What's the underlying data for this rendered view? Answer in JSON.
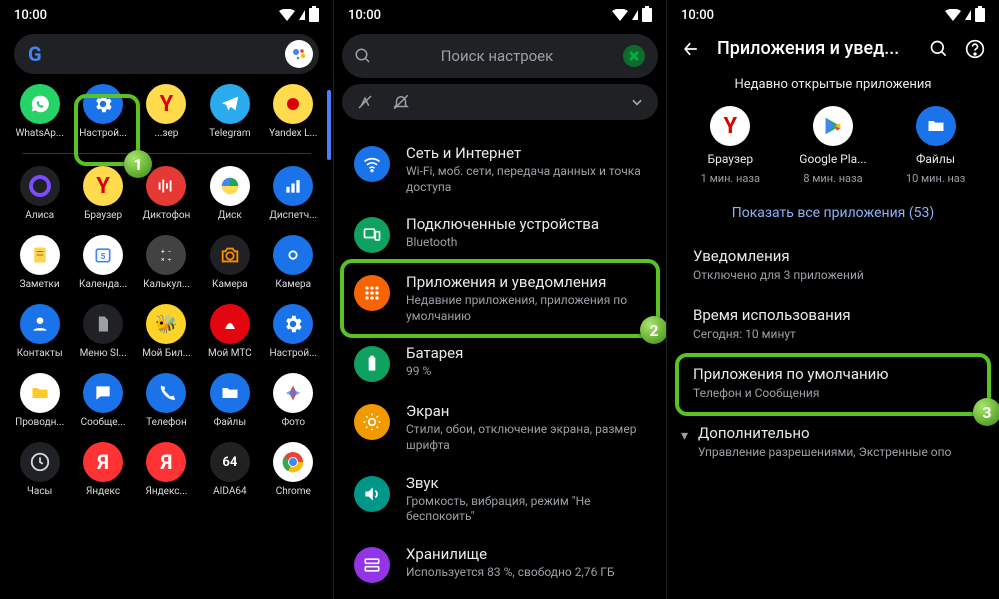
{
  "status_time": "10:00",
  "p1": {
    "apps": [
      [
        {
          "name": "WhatsAp...",
          "bg": "#25d366",
          "glyph": "wa"
        },
        {
          "name": "Настрой...",
          "bg": "#1a73e8",
          "glyph": "gear"
        },
        {
          "name": "...зер",
          "bg": "#ffdb4d",
          "glyph": "Y"
        },
        {
          "name": "Telegram",
          "bg": "#2aabee",
          "glyph": "tg"
        },
        {
          "name": "Yandex L...",
          "bg": "#ffdb4d",
          "glyph": "dot"
        }
      ],
      [
        {
          "name": "Алиса",
          "bg": "#202124",
          "glyph": "circle"
        },
        {
          "name": "Браузер",
          "bg": "#ffdb4d",
          "glyph": "Y"
        },
        {
          "name": "Диктофон",
          "bg": "#e53935",
          "glyph": "rec"
        },
        {
          "name": "Диск",
          "bg": "#fff",
          "glyph": "disk"
        },
        {
          "name": "Диспетч...",
          "bg": "#1a73e8",
          "glyph": "bars"
        }
      ],
      [
        {
          "name": "Заметки",
          "bg": "#fff",
          "glyph": "note"
        },
        {
          "name": "Календа...",
          "bg": "#fff",
          "glyph": "cal"
        },
        {
          "name": "Калькул...",
          "bg": "#424242",
          "glyph": "calc"
        },
        {
          "name": "Камера",
          "bg": "#202124",
          "glyph": "cam"
        },
        {
          "name": "Камера",
          "bg": "#1a73e8",
          "glyph": "cam2"
        }
      ],
      [
        {
          "name": "Контакты",
          "bg": "#1a73e8",
          "glyph": "contact"
        },
        {
          "name": "Меню SI...",
          "bg": "#202124",
          "glyph": "sim"
        },
        {
          "name": "Мой Бил...",
          "bg": "#fed42b",
          "glyph": "bee"
        },
        {
          "name": "Мой МТС",
          "bg": "#e30611",
          "glyph": "mts"
        },
        {
          "name": "Настрой...",
          "bg": "#1a73e8",
          "glyph": "gear"
        }
      ],
      [
        {
          "name": "Проводн...",
          "bg": "#fff",
          "glyph": "folder"
        },
        {
          "name": "Сообще...",
          "bg": "#1a73e8",
          "glyph": "msg"
        },
        {
          "name": "Телефон",
          "bg": "#1a73e8",
          "glyph": "phone"
        },
        {
          "name": "Файлы",
          "bg": "#1a73e8",
          "glyph": "folder2"
        },
        {
          "name": "Фото",
          "bg": "#fff",
          "glyph": "photo"
        }
      ],
      [
        {
          "name": "Часы",
          "bg": "#202124",
          "glyph": "clock"
        },
        {
          "name": "Яндекс",
          "bg": "#f33",
          "glyph": "Ya"
        },
        {
          "name": "Яндекс...",
          "bg": "#f33",
          "glyph": "Ya"
        },
        {
          "name": "AIDA64",
          "bg": "#212121",
          "glyph": "a64"
        },
        {
          "name": "Chrome",
          "bg": "#fff",
          "glyph": "chrome"
        }
      ]
    ]
  },
  "p2": {
    "search_placeholder": "Поиск настроек",
    "items": [
      {
        "title": "Сеть и Интернет",
        "sub": "Wi-Fi, моб. сети, передача данных и точка доступа",
        "bg": "#1a73e8",
        "icon": "wifi"
      },
      {
        "title": "Подключенные устройства",
        "sub": "Bluetooth",
        "bg": "#10a060",
        "icon": "devices"
      },
      {
        "title": "Приложения и уведомления",
        "sub": "Недавние приложения, приложения по умолчанию",
        "bg": "#f86500",
        "icon": "apps",
        "hl": true,
        "badge": "2"
      },
      {
        "title": "Батарея",
        "sub": "99 %",
        "bg": "#10a060",
        "icon": "battery"
      },
      {
        "title": "Экран",
        "sub": "Стили, обои, отключение экрана, размер шрифта",
        "bg": "#f29900",
        "icon": "display"
      },
      {
        "title": "Звук",
        "sub": "Громкость, вибрация, режим \"Не беспокоить\"",
        "bg": "#009688",
        "icon": "sound"
      },
      {
        "title": "Хранилище",
        "sub": "Используется 83 %, свободно 2,76 ГБ",
        "bg": "#9334e6",
        "icon": "storage"
      }
    ]
  },
  "p3": {
    "title": "Приложения и увед...",
    "section": "Недавно открытые приложения",
    "recent": [
      {
        "name": "Браузер",
        "sub": "1 мин. наза",
        "bg": "#fff",
        "glyph": "Y"
      },
      {
        "name": "Google Pla...",
        "sub": "8 мин. наза",
        "bg": "#fff",
        "glyph": "play"
      },
      {
        "name": "Файлы",
        "sub": "10 мин. наз",
        "bg": "#1a73e8",
        "glyph": "folder2"
      }
    ],
    "show_all": "Показать все приложения (53)",
    "rows": [
      {
        "title": "Уведомления",
        "sub": "Отключено для 3 приложений"
      },
      {
        "title": "Время использования",
        "sub": "Сегодня: 10 минут"
      },
      {
        "title": "Приложения по умолчанию",
        "sub": "Телефон и Сообщения",
        "hl": true,
        "badge": "3"
      },
      {
        "title": "Дополнительно",
        "sub": "Управление разрешениями, Экстренные опо",
        "chev": true
      }
    ]
  }
}
